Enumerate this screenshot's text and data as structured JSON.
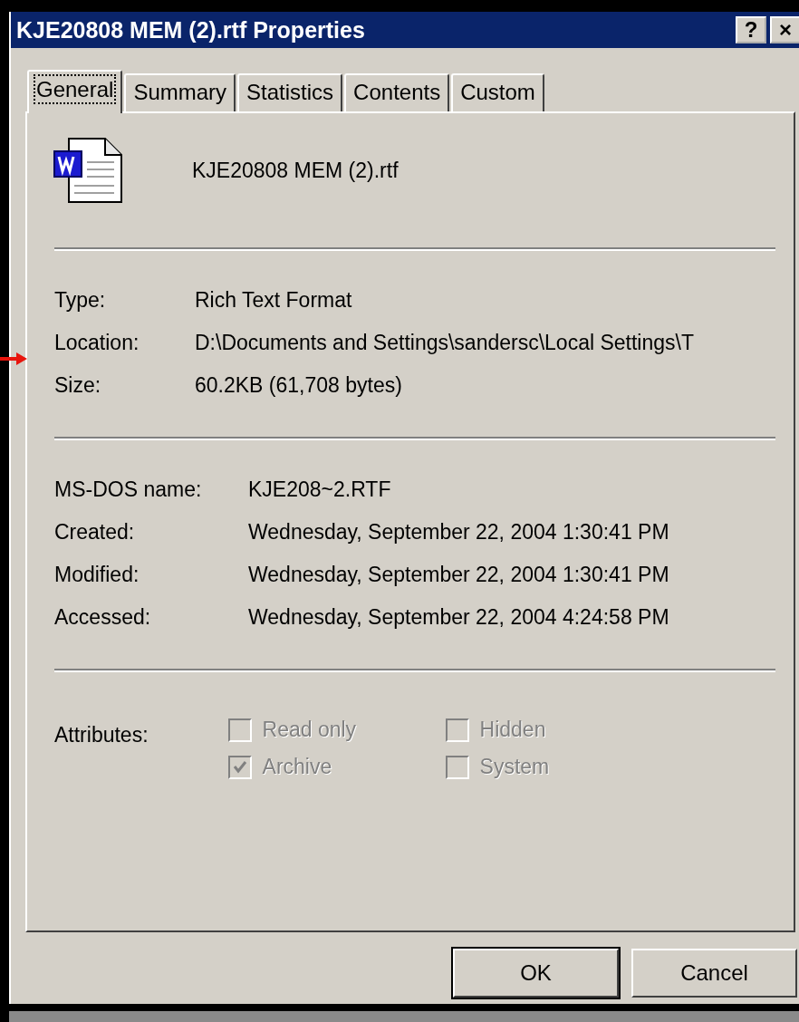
{
  "window": {
    "title": "KJE20808 MEM (2).rtf Properties",
    "title_buttons": [
      "?",
      "×"
    ]
  },
  "tabs": [
    {
      "label": "General",
      "selected": true
    },
    {
      "label": "Summary",
      "selected": false
    },
    {
      "label": "Statistics",
      "selected": false
    },
    {
      "label": "Contents",
      "selected": false
    },
    {
      "label": "Custom",
      "selected": false
    }
  ],
  "file": {
    "name": "KJE20808 MEM (2).rtf"
  },
  "details": [
    {
      "label": "Type:",
      "value": "Rich Text Format"
    },
    {
      "label": "Location:",
      "value": "D:\\Documents and Settings\\sandersc\\Local Settings\\T"
    },
    {
      "label": "Size:",
      "value": "60.2KB (61,708 bytes)"
    }
  ],
  "dates": [
    {
      "label": "MS-DOS name:",
      "value": "KJE208~2.RTF"
    },
    {
      "label": "Created:",
      "value": "Wednesday, September 22, 2004 1:30:41 PM"
    },
    {
      "label": "Modified:",
      "value": "Wednesday, September 22, 2004 1:30:41 PM"
    },
    {
      "label": "Accessed:",
      "value": "Wednesday, September 22, 2004 4:24:58 PM"
    }
  ],
  "attributes": {
    "label": "Attributes:",
    "items": [
      {
        "label": "Read only",
        "checked": false,
        "disabled": true
      },
      {
        "label": "Hidden",
        "checked": false,
        "disabled": true
      },
      {
        "label": "Archive",
        "checked": true,
        "disabled": true
      },
      {
        "label": "System",
        "checked": false,
        "disabled": true
      }
    ]
  },
  "buttons": [
    "OK",
    "Cancel"
  ]
}
